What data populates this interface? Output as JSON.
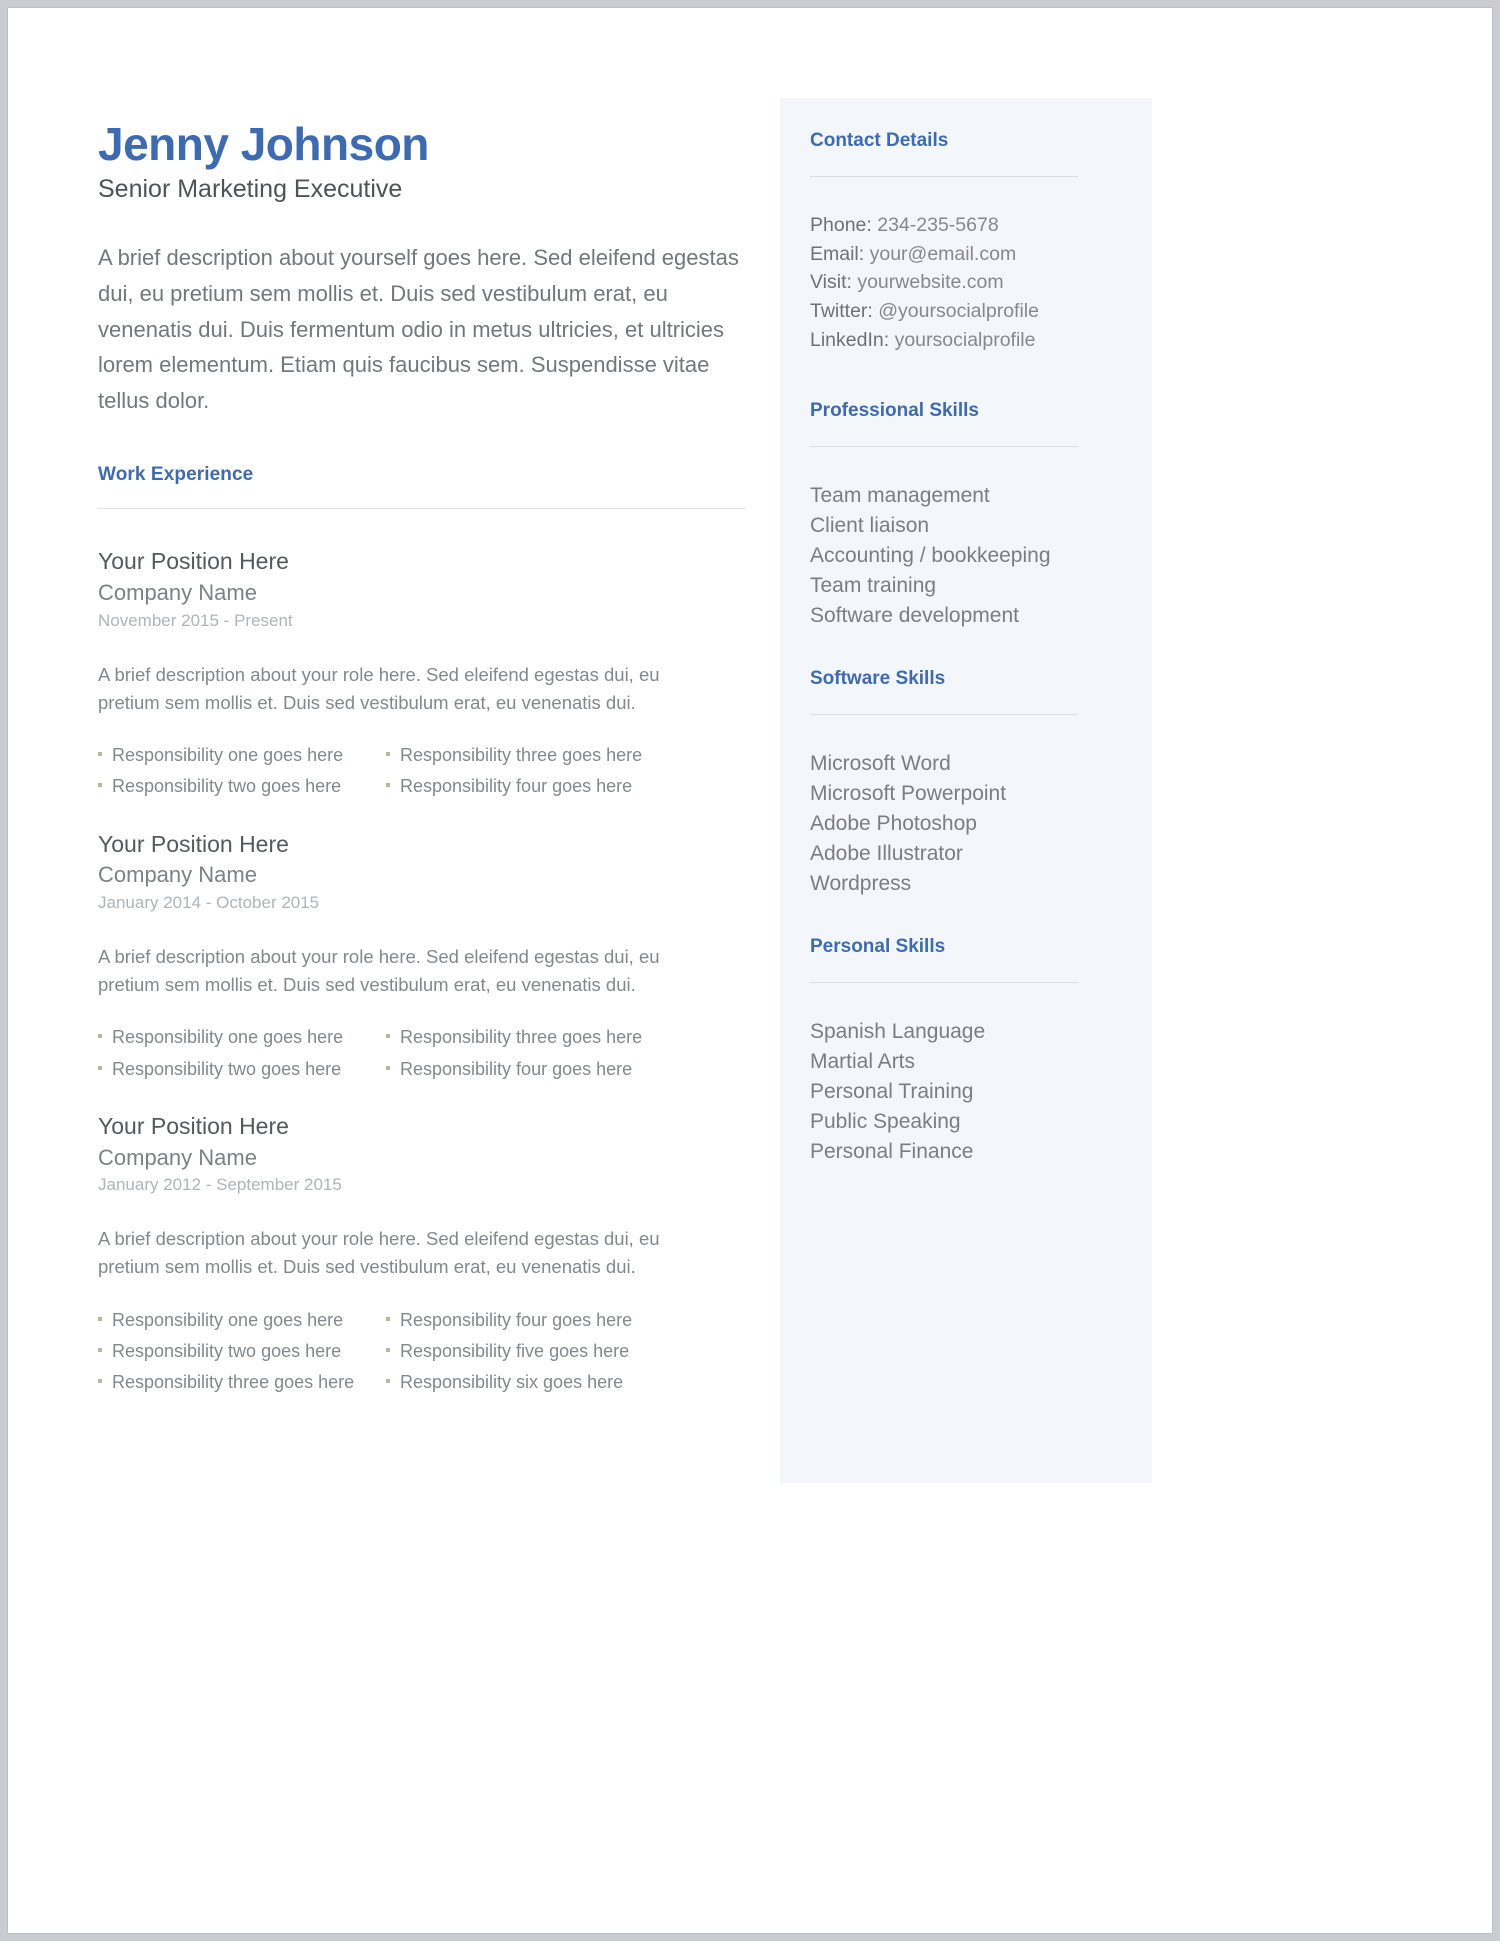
{
  "theme": {
    "accent": "#3d6bb3",
    "body_text": "#84888c",
    "sidebar_bg": "#f3f6fa",
    "bullet": "#b9b59a"
  },
  "header": {
    "name": "Jenny Johnson",
    "title": "Senior Marketing Executive",
    "summary": "A brief description about yourself goes here. Sed eleifend egestas dui, eu pretium sem mollis et. Duis sed vestibulum erat, eu venenatis dui. Duis fermentum odio in metus ultricies, et ultricies lorem elementum. Etiam quis faucibus sem. Suspendisse vitae tellus dolor."
  },
  "work": {
    "heading": "Work Experience",
    "entries": [
      {
        "position": "Your Position Here",
        "company": "Company Name",
        "dates": "November 2015 - Present",
        "description": "A brief description about your role here. Sed eleifend egestas dui, eu pretium sem mollis et. Duis sed vestibulum erat, eu venenatis dui.",
        "responsibilities": [
          "Responsibility one goes here",
          "Responsibility two goes here",
          "Responsibility three goes here",
          "Responsibility four goes here"
        ]
      },
      {
        "position": "Your Position Here",
        "company": "Company Name",
        "dates": "January 2014 - October 2015",
        "description": "A brief description about your role here. Sed eleifend egestas dui, eu pretium sem mollis et. Duis sed vestibulum erat, eu venenatis dui.",
        "responsibilities": [
          "Responsibility one goes here",
          "Responsibility two goes here",
          "Responsibility three goes here",
          "Responsibility four goes here"
        ]
      },
      {
        "position": "Your Position Here",
        "company": "Company Name",
        "dates": "January 2012 - September 2015",
        "description": "A brief description about your role here. Sed eleifend egestas dui, eu pretium sem mollis et. Duis sed vestibulum erat, eu venenatis dui.",
        "responsibilities": [
          "Responsibility one goes here",
          "Responsibility two goes here",
          "Responsibility three goes here",
          "Responsibility four goes here",
          "Responsibility five goes here",
          "Responsibility six goes here"
        ]
      }
    ]
  },
  "sidebar": {
    "contact": {
      "heading": "Contact Details",
      "items": [
        {
          "label": "Phone:",
          "value": "234-235-5678"
        },
        {
          "label": "Email:",
          "value": "your@email.com"
        },
        {
          "label": "Visit:",
          "value": " yourwebsite.com"
        },
        {
          "label": "Twitter:",
          "value": "@yoursocialprofile"
        },
        {
          "label": "LinkedIn:",
          "value": "yoursocialprofile"
        }
      ]
    },
    "professional_skills": {
      "heading": "Professional Skills",
      "items": [
        "Team management",
        "Client liaison",
        "Accounting / bookkeeping",
        "Team training",
        "Software development"
      ]
    },
    "software_skills": {
      "heading": "Software Skills",
      "items": [
        "Microsoft Word",
        "Microsoft Powerpoint",
        "Adobe Photoshop",
        "Adobe Illustrator",
        "Wordpress"
      ]
    },
    "personal_skills": {
      "heading": "Personal Skills",
      "items": [
        "Spanish Language",
        "Martial Arts",
        "Personal Training",
        "Public Speaking",
        "Personal Finance"
      ]
    }
  }
}
